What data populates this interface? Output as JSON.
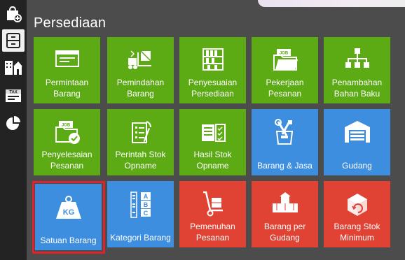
{
  "sidebar": {
    "items": [
      {
        "name": "shop-add-icon"
      },
      {
        "name": "cabinet-icon",
        "active": true
      },
      {
        "name": "building-icon"
      },
      {
        "name": "tax-icon"
      },
      {
        "name": "pie-chart-icon"
      }
    ]
  },
  "page": {
    "title": "Persediaan"
  },
  "tiles": [
    {
      "label": "Permintaan\nBarang",
      "color": "#5cab14",
      "icon": "request-icon"
    },
    {
      "label": "Pemindahan\nBarang",
      "color": "#5cab14",
      "icon": "forklift-icon"
    },
    {
      "label": "Penyesuaian\nPersediaan",
      "color": "#5cab14",
      "icon": "shelves-icon"
    },
    {
      "label": "Pekerjaan\nPesanan",
      "color": "#5cab14",
      "icon": "job-folder-icon"
    },
    {
      "label": "Penambahan\nBahan Baku",
      "color": "#5cab14",
      "icon": "hierarchy-boxes-icon"
    },
    {
      "label": "Penyelesaian\nPesanan",
      "color": "#5cab14",
      "icon": "job-done-icon"
    },
    {
      "label": "Perintah Stok\nOpname",
      "color": "#5cab14",
      "icon": "checklist-pencil-icon"
    },
    {
      "label": "Hasil Stok\nOpname",
      "color": "#5cab14",
      "icon": "checklist-result-icon"
    },
    {
      "label": "Barang & Jasa",
      "color": "#3e8ee0",
      "icon": "tools-box-icon"
    },
    {
      "label": "Gudang",
      "color": "#3e8ee0",
      "icon": "warehouse-icon"
    },
    {
      "label": "Satuan Barang",
      "color": "#3e8ee0",
      "icon": "kg-weight-icon",
      "icon_text": "KG"
    },
    {
      "label": "Kategori Barang",
      "color": "#3e8ee0",
      "icon": "abc-category-icon",
      "icon_text": "A B C"
    },
    {
      "label": "Pemenuhan\nPesanan",
      "color": "#e04234",
      "icon": "hand-truck-icon"
    },
    {
      "label": "Barang per\nGudang",
      "color": "#e04234",
      "icon": "stacked-boxes-icon"
    },
    {
      "label": "Barang Stok\nMinimum",
      "color": "#e04234",
      "icon": "box-refresh-icon"
    }
  ]
}
